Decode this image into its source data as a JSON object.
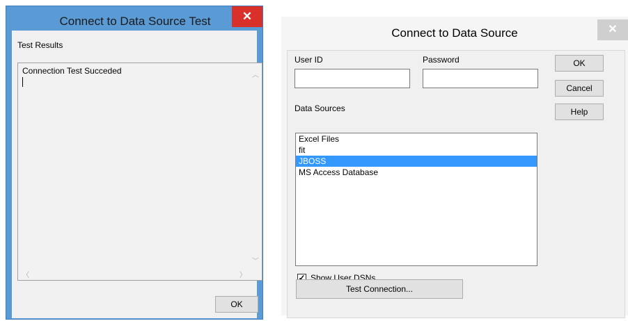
{
  "front_dialog": {
    "title": "Connect to Data Source Test",
    "close_glyph": "✕",
    "section_label": "Test Results",
    "result_text": "Connection Test Succeded",
    "ok_label": "OK"
  },
  "back_dialog": {
    "title": "Connect to Data Source",
    "close_glyph": "✕",
    "user_id_label": "User ID",
    "user_id_value": "",
    "password_label": "Password",
    "password_value": "",
    "data_sources_label": "Data Sources",
    "data_sources": [
      "Excel Files",
      "fit",
      "JBOSS",
      "MS Access Database"
    ],
    "selected_data_source": "JBOSS",
    "show_user_dsns_label": "Show User DSNs",
    "show_user_dsns_checked": true,
    "buttons": {
      "ok": "OK",
      "cancel": "Cancel",
      "help": "Help",
      "test_connection": "Test Connection..."
    }
  },
  "colors": {
    "active_titlebar": "#5b9bd5",
    "close_active": "#d9302a",
    "selection": "#3399ff"
  }
}
